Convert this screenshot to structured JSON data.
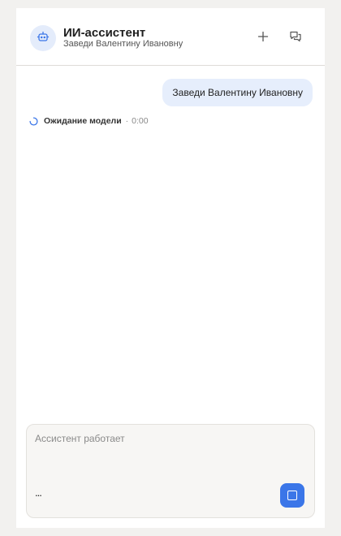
{
  "header": {
    "title": "ИИ-ассистент",
    "subtitle": "Заведи Валентину Ивановну",
    "avatar_icon": "bot-icon",
    "new_chat_icon": "plus-icon",
    "history_icon": "chat-history-icon"
  },
  "messages": [
    {
      "role": "user",
      "text": "Заведи Валентину Ивановну"
    }
  ],
  "status": {
    "label": "Ожидание модели",
    "separator": "·",
    "time": "0:00",
    "icon": "spinner-icon"
  },
  "composer": {
    "placeholder": "Ассистент работает",
    "more_label": "...",
    "stop_icon": "stop-icon"
  },
  "colors": {
    "accent": "#3b76e8",
    "user_bubble": "#e6eefc",
    "avatar_bg": "#e4ecfb",
    "page_bg": "#f2f1ef"
  }
}
